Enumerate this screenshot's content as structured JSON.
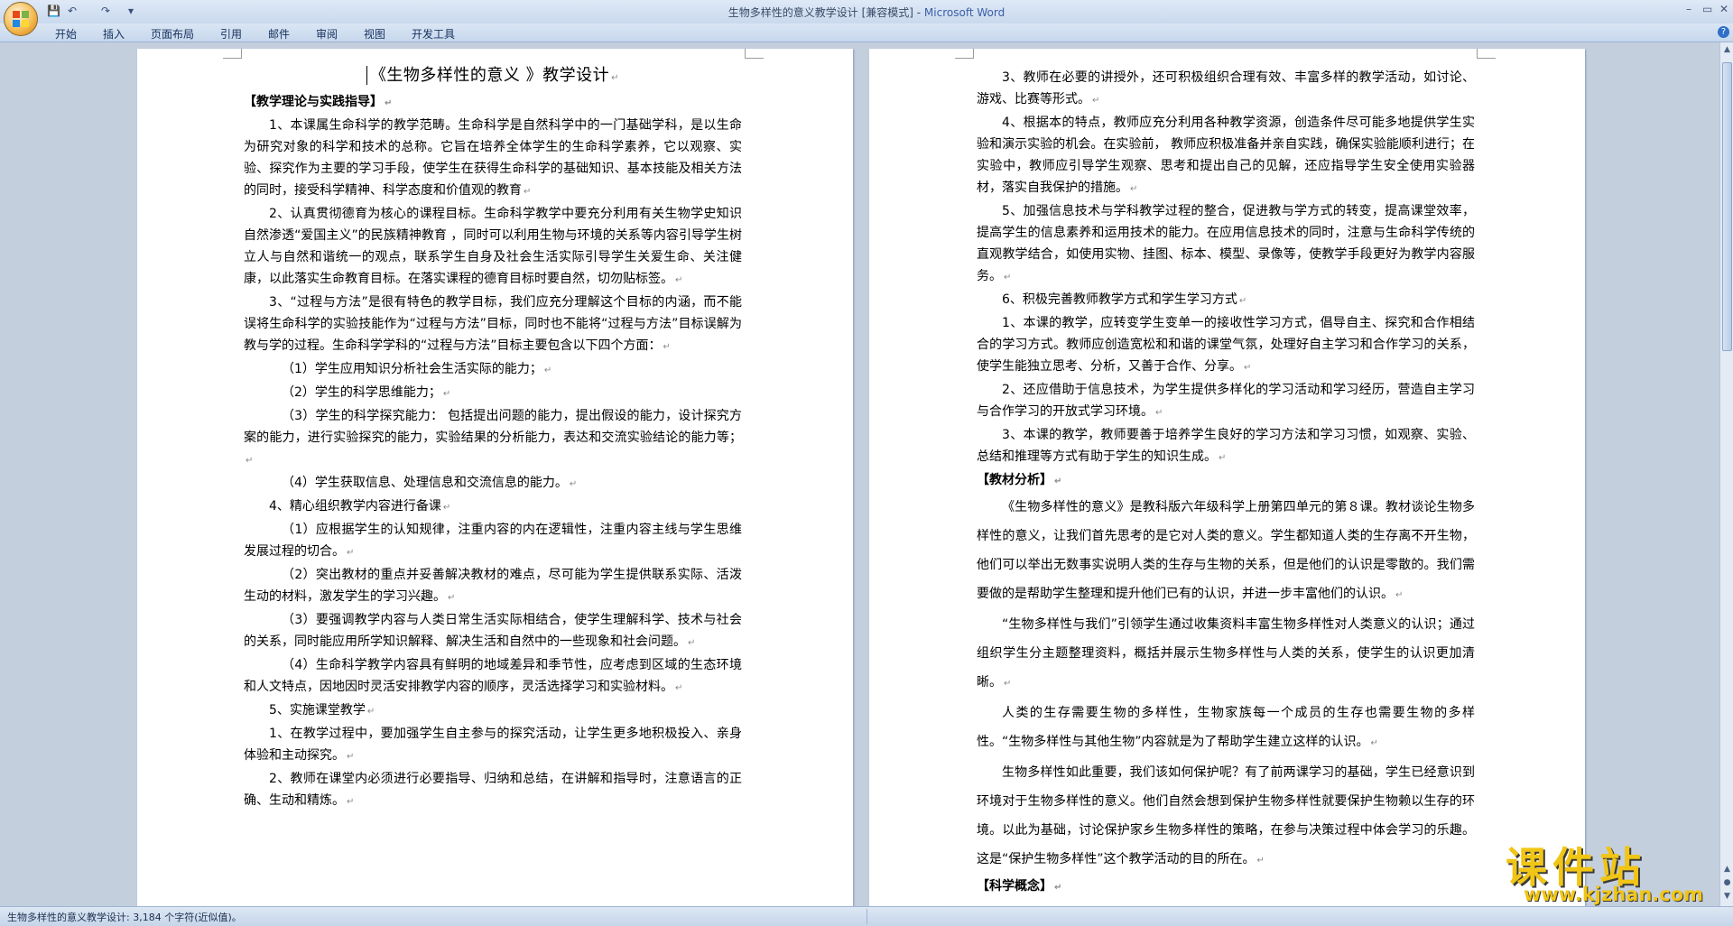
{
  "window": {
    "title": "生物多样性的意义教学设计 [兼容模式] - ",
    "app": "Microsoft Word",
    "controls": [
      "–",
      "▭",
      "✕"
    ]
  },
  "quick_access": {
    "save": "💾",
    "undo": "↶",
    "redo": "↷",
    "menu": "▾"
  },
  "ribbon": {
    "tabs": [
      "开始",
      "插入",
      "页面布局",
      "引用",
      "邮件",
      "审阅",
      "视图",
      "开发工具"
    ],
    "help": "?"
  },
  "page1": {
    "title": "《生物多样性的意义 》教学设计",
    "paragraphs": [
      {
        "t": "【教学理论与实践指导】",
        "k": "h"
      },
      {
        "t": "1、本课属生命科学的教学范畴。生命科学是自然科学中的一门基础学科，是以生命为研究对象的科学和技术的总称。它旨在培养全体学生的生命科学素养，它以观察、实验、探究作为主要的学习手段，使学生在获得生命科学的基础知识、基本技能及相关方法的同时，接受科学精神、科学态度和价值观的教育"
      },
      {
        "t": "2、认真贯彻德育为核心的课程目标。生命科学教学中要充分利用有关生物学史知识自然渗透“爱国主义”的民族精神教育 ，同时可以利用生物与环境的关系等内容引导学生树立人与自然和谐统一的观点，联系学生自身及社会生活实际引导学生关爱生命、关注健康，以此落实生命教育目标。在落实课程的德育目标时要自然，切勿贴标签。"
      },
      {
        "t": "3、“过程与方法”是很有特色的教学目标，我们应充分理解这个目标的内涵，而不能误将生命科学的实验技能作为“过程与方法”目标，同时也不能将“过程与方法”目标误解为教与学的过程。生命科学学科的“过程与方法”目标主要包含以下四个方面："
      },
      {
        "t": "（1）学生应用知识分析社会生活实际的能力；",
        "k": "sub"
      },
      {
        "t": "（2）学生的科学思维能力；",
        "k": "sub"
      },
      {
        "t": "（3）学生的科学探究能力： 包括提出问题的能力，提出假设的能力，设计探究方案的能力，进行实验探究的能力，实验结果的分析能力，表达和交流实验结论的能力等；",
        "k": "sub"
      },
      {
        "t": "（4）学生获取信息、处理信息和交流信息的能力。",
        "k": "sub"
      },
      {
        "t": "4、精心组织教学内容进行备课"
      },
      {
        "t": "（1）应根据学生的认知规律，注重内容的内在逻辑性，注重内容主线与学生思维发展过程的切合。",
        "k": "sub"
      },
      {
        "t": "（2）突出教材的重点并妥善解决教材的难点，尽可能为学生提供联系实际、活泼生动的材料，激发学生的学习兴趣。",
        "k": "sub"
      },
      {
        "t": "（3）要强调教学内容与人类日常生活实际相结合，使学生理解科学、技术与社会的关系，同时能应用所学知识解释、解决生活和自然中的一些现象和社会问题。",
        "k": "sub"
      },
      {
        "t": "（4）生命科学教学内容具有鲜明的地域差异和季节性，应考虑到区域的生态环境和人文特点，因地因时灵活安排教学内容的顺序，灵活选择学习和实验材料。",
        "k": "sub"
      },
      {
        "t": "5、实施课堂教学"
      },
      {
        "t": "1、在教学过程中，要加强学生自主参与的探究活动，让学生更多地积极投入、亲身体验和主动探究。"
      },
      {
        "t": "2、教师在课堂内必须进行必要指导、归纳和总结，在讲解和指导时，注意语言的正确、生动和精炼。"
      }
    ]
  },
  "page2": {
    "paragraphs": [
      {
        "t": "3、教师在必要的讲授外，还可积极组织合理有效、丰富多样的教学活动，如讨论、游戏、比赛等形式。"
      },
      {
        "t": "4、根据本的特点，教师应充分利用各种教学资源，创造条件尽可能多地提供学生实验和演示实验的机会。在实验前， 教师应积极准备并亲自实践，确保实验能顺利进行；在实验中，教师应引导学生观察、思考和提出自己的见解，还应指导学生安全使用实验器材，落实自我保护的措施。"
      },
      {
        "t": "5、加强信息技术与学科教学过程的整合，促进教与学方式的转变，提高课堂效率，提高学生的信息素养和运用技术的能力。在应用信息技术的同时，注意与生命科学传统的直观教学结合，如使用实物、挂图、标本、模型、录像等，使教学手段更好为教学内容服务。"
      },
      {
        "t": "6、积极完善教师教学方式和学生学习方式"
      },
      {
        "t": "1、本课的教学，应转变学生变单一的接收性学习方式，倡导自主、探究和合作相结合的学习方式。教师应创造宽松和和谐的课堂气氛，处理好自主学习和合作学习的关系，使学生能独立思考、分析，又善于合作、分享。"
      },
      {
        "t": "2、还应借助于信息技术，为学生提供多样化的学习活动和学习经历，营造自主学习与合作学习的开放式学习环境。"
      },
      {
        "t": "3、本课的教学，教师要善于培养学生良好的学习方法和学习习惯，如观察、实验、总结和推理等方式有助于学生的知识生成。"
      },
      {
        "t": "【教材分析】",
        "k": "h"
      },
      {
        "t": "《生物多样性的意义》是教科版六年级科学上册第四单元的第８课。教材谈论生物多样性的意义，让我们首先思考的是它对人类的意义。学生都知道人类的生存离不开生物，他们可以举出无数事实说明人类的生存与生物的关系，但是他们的认识是零散的。我们需要做的是帮助学生整理和提升他们已有的认识，并进一步丰富他们的认识。",
        "k": "tall"
      },
      {
        "t": "“生物多样性与我们”引领学生通过收集资料丰富生物多样性对人类意义的认识；通过组织学生分主题整理资料，概括并展示生物多样性与人类的关系，使学生的认识更加清晰。",
        "k": "tall"
      },
      {
        "t": "人类的生存需要生物的多样性，生物家族每一个成员的生存也需要生物的多样性。“生物多样性与其他生物”内容就是为了帮助学生建立这样的认识。",
        "k": "tall"
      },
      {
        "t": "生物多样性如此重要，我们该如何保护呢？有了前两课学习的基础，学生已经意识到环境对于生物多样性的意义。他们自然会想到保护生物多样性就要保护生物赖以生存的环境。以此为基础，讨论保护家乡生物多样性的策略，在参与决策过程中体会学习的乐趣。这是“保护生物多样性”这个教学活动的目的所在。",
        "k": "tall"
      },
      {
        "t": "【科学概念】",
        "k": "h"
      }
    ]
  },
  "status": {
    "text": "生物多样性的意义教学设计: 3,184 个字符(近似值)。"
  },
  "watermark": {
    "cn": "课件站",
    "url": "www.kjzhan.com"
  },
  "scroll": {
    "up": "▲",
    "down": "▼",
    "prev": "▲",
    "next": "▼"
  }
}
